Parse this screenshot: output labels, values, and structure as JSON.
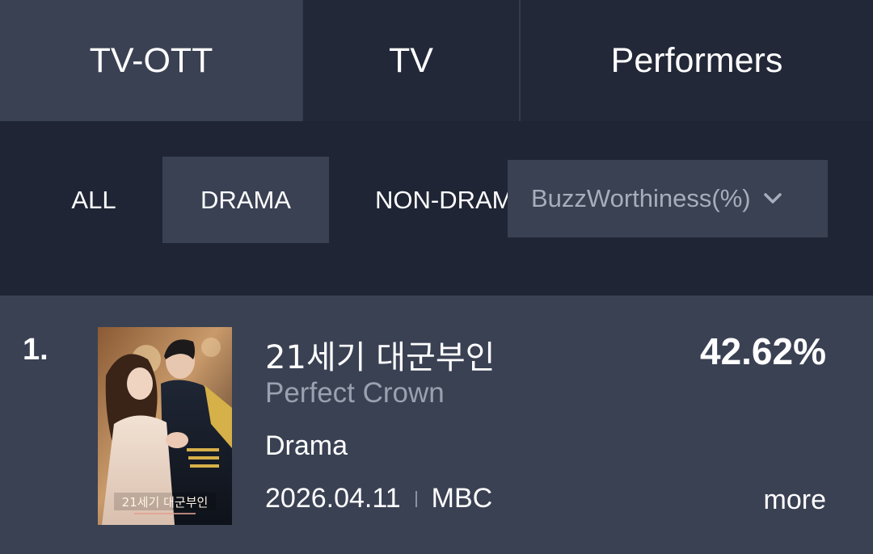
{
  "top_tabs": [
    {
      "label": "TV-OTT",
      "active": true
    },
    {
      "label": "TV",
      "active": false
    },
    {
      "label": "Performers",
      "active": false
    }
  ],
  "filters": {
    "chips": [
      {
        "label": "ALL",
        "active": false
      },
      {
        "label": "DRAMA",
        "active": true
      },
      {
        "label": "NON-DRAMA",
        "active": false
      }
    ],
    "metric_select": {
      "value": "BuzzWorthiness(%)",
      "icon": "chevron-down-icon"
    }
  },
  "ranking": [
    {
      "rank": "1.",
      "title_ko": "21세기 대군부인",
      "title_en": "Perfect Crown",
      "genre": "Drama",
      "date": "2026.04.11",
      "channel": "MBC",
      "score": "42.62%",
      "more_label": "more",
      "poster_caption": "21세기 대군부인"
    }
  ],
  "colors": {
    "background": "#1f2535",
    "active_tab": "#3a4153",
    "muted_text": "#9aa1af"
  }
}
